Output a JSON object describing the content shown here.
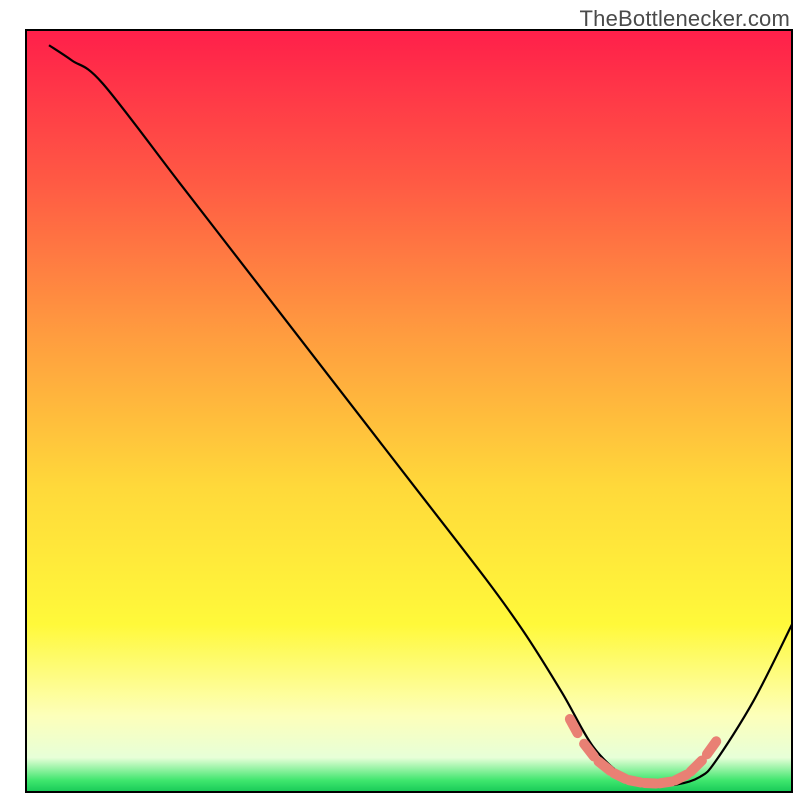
{
  "attribution": "TheBottlenecker.com",
  "chart_data": {
    "type": "line",
    "title": "",
    "xlabel": "",
    "ylabel": "",
    "xlim": [
      0,
      100
    ],
    "ylim": [
      0,
      100
    ],
    "grid": false,
    "series": [
      {
        "name": "bottleneck-curve",
        "x": [
          3,
          6,
          10,
          20,
          30,
          40,
          50,
          60,
          65,
          70,
          74,
          78,
          80,
          82,
          85,
          88,
          90,
          95,
          100
        ],
        "y": [
          98,
          96,
          93,
          80,
          67,
          54,
          41,
          28,
          21,
          13,
          6,
          2,
          1,
          1,
          1,
          2,
          4,
          12,
          22
        ]
      }
    ],
    "highlight_band": {
      "name": "optimal-region",
      "x": [
        70.5,
        72.5,
        74.5,
        76.5,
        78.5,
        80.5,
        82.5,
        84.5,
        86.5,
        88.5,
        90.5
      ],
      "y": [
        10.5,
        6.8,
        4.2,
        2.6,
        1.6,
        1.2,
        1.1,
        1.4,
        2.4,
        4.4,
        7.2
      ]
    },
    "background_gradient_stops": [
      {
        "offset": 0.0,
        "color": "#ff1f4a"
      },
      {
        "offset": 0.2,
        "color": "#ff5a44"
      },
      {
        "offset": 0.4,
        "color": "#ff9c3f"
      },
      {
        "offset": 0.6,
        "color": "#ffd93a"
      },
      {
        "offset": 0.78,
        "color": "#fff93a"
      },
      {
        "offset": 0.9,
        "color": "#fdffba"
      },
      {
        "offset": 0.955,
        "color": "#e7ffd8"
      },
      {
        "offset": 0.985,
        "color": "#3ee66d"
      },
      {
        "offset": 1.0,
        "color": "#17c958"
      }
    ],
    "colors": {
      "curve": "#000000",
      "highlight": "#e98074",
      "frame": "#000000"
    }
  }
}
